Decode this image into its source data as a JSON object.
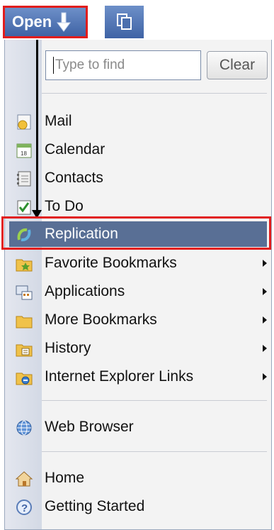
{
  "toolbar": {
    "open_label": "Open",
    "open_icon": "down-arrow-icon",
    "window_icon": "windows-icon"
  },
  "search": {
    "placeholder": "Type to find",
    "clear_label": "Clear"
  },
  "menu": {
    "items": [
      {
        "label": "Mail",
        "icon": "mail-icon"
      },
      {
        "label": "Calendar",
        "icon": "calendar-icon"
      },
      {
        "label": "Contacts",
        "icon": "contacts-icon"
      },
      {
        "label": "To Do",
        "icon": "todo-icon"
      },
      {
        "label": "Replication",
        "icon": "replication-icon",
        "selected": true
      },
      {
        "label": "Favorite Bookmarks",
        "icon": "folder-star-icon",
        "submenu": true
      },
      {
        "label": "Applications",
        "icon": "applications-icon",
        "submenu": true
      },
      {
        "label": "More Bookmarks",
        "icon": "folder-icon",
        "submenu": true
      },
      {
        "label": "History",
        "icon": "history-folder-icon",
        "submenu": true
      },
      {
        "label": "Internet Explorer Links",
        "icon": "ie-folder-icon",
        "submenu": true
      },
      {
        "label": "Web Browser",
        "icon": "globe-icon"
      },
      {
        "label": "Home",
        "icon": "home-icon"
      },
      {
        "label": "Getting Started",
        "icon": "help-icon"
      }
    ]
  },
  "colors": {
    "highlight": "#e11d1d",
    "selection": "#596f95",
    "toolbar_button": "#4a6fae"
  }
}
